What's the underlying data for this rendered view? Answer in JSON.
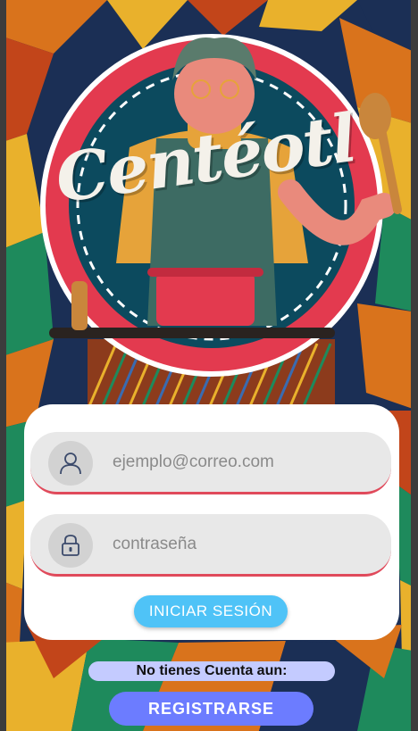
{
  "app": {
    "logo_text": "Centéotl"
  },
  "login": {
    "email_placeholder": "ejemplo@correo.com",
    "email_value": "",
    "password_placeholder": "contraseña",
    "password_value": "",
    "submit_label": "INICIAR SESIÓN"
  },
  "signup": {
    "prompt": "No tienes Cuenta aun:",
    "button_label": "REGISTRARSE"
  },
  "icons": {
    "email": "user-icon",
    "password": "lock-icon"
  },
  "colors": {
    "accent_red": "#e04a5b",
    "login_button": "#4fc3f7",
    "register_button": "#6c7cff",
    "prompt_bg": "#c4cbff",
    "badge_teal": "#0c4a5e",
    "background_navy": "#1b2f55",
    "background_orange": "#d9731c",
    "background_yellow": "#e9b12c",
    "background_green": "#1e8a5c"
  }
}
